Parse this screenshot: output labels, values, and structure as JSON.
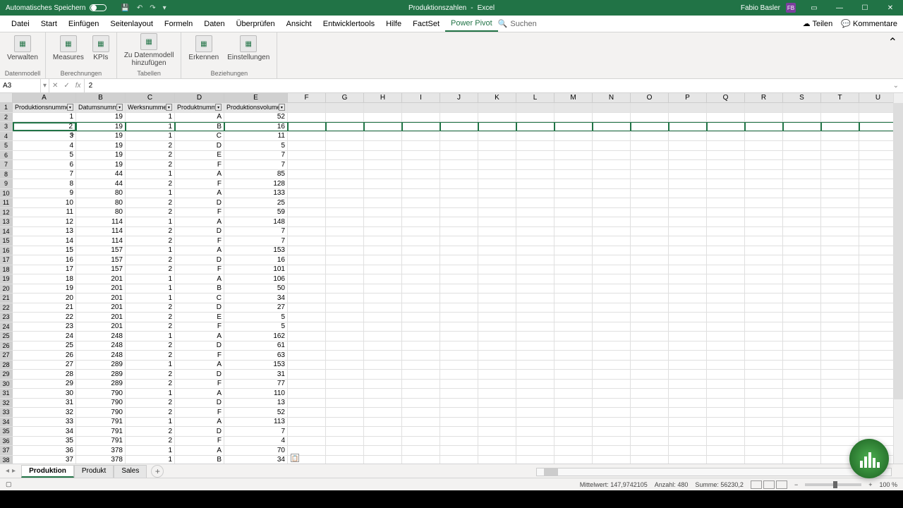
{
  "titlebar": {
    "autosave_label": "Automatisches Speichern",
    "doc_title": "Produktionszahlen",
    "app_name": "Excel",
    "user_name": "Fabio Basler",
    "user_initials": "FB"
  },
  "menu": {
    "tabs": [
      "Datei",
      "Start",
      "Einfügen",
      "Seitenlayout",
      "Formeln",
      "Daten",
      "Überprüfen",
      "Ansicht",
      "Entwicklertools",
      "Hilfe",
      "FactSet",
      "Power Pivot"
    ],
    "active_index": 11,
    "search_label": "Suchen",
    "share_label": "Teilen",
    "comments_label": "Kommentare"
  },
  "ribbon": {
    "groups": [
      {
        "label": "Datenmodell",
        "buttons": [
          {
            "label": "Verwalten"
          }
        ]
      },
      {
        "label": "Berechnungen",
        "buttons": [
          {
            "label": "Measures"
          },
          {
            "label": "KPIs"
          }
        ]
      },
      {
        "label": "Tabellen",
        "buttons": [
          {
            "label": "Zu Datenmodell\nhinzufügen"
          }
        ]
      },
      {
        "label": "Beziehungen",
        "buttons": [
          {
            "label": "Erkennen"
          },
          {
            "label": "Einstellungen"
          }
        ]
      }
    ]
  },
  "formula_bar": {
    "name_box": "A3",
    "formula": "2"
  },
  "grid": {
    "col_widths": {
      "A": 90,
      "B": 70,
      "C": 70,
      "D": 70,
      "E": 90,
      "rest": 54
    },
    "col_letters": [
      "A",
      "B",
      "C",
      "D",
      "E",
      "F",
      "G",
      "H",
      "I",
      "J",
      "K",
      "L",
      "M",
      "N",
      "O",
      "P",
      "Q",
      "R",
      "S",
      "T",
      "U"
    ],
    "table_headers": [
      "Produktionsnummer",
      "Datumsnummer",
      "Werksnummer",
      "Produktnummer",
      "Produktionsvolumen"
    ],
    "active_cell": "A3",
    "chart_data": {
      "type": "table",
      "columns": [
        "Produktionsnummer",
        "Datumsnummer",
        "Werksnummer",
        "Produktnummer",
        "Produktionsvolumen"
      ],
      "rows": [
        [
          1,
          19,
          1,
          "A",
          52
        ],
        [
          2,
          19,
          1,
          "B",
          16
        ],
        [
          3,
          19,
          1,
          "C",
          11
        ],
        [
          4,
          19,
          2,
          "D",
          5
        ],
        [
          5,
          19,
          2,
          "E",
          7
        ],
        [
          6,
          19,
          2,
          "F",
          7
        ],
        [
          7,
          44,
          1,
          "A",
          85
        ],
        [
          8,
          44,
          2,
          "F",
          128
        ],
        [
          9,
          80,
          1,
          "A",
          133
        ],
        [
          10,
          80,
          2,
          "D",
          25
        ],
        [
          11,
          80,
          2,
          "F",
          59
        ],
        [
          12,
          114,
          1,
          "A",
          148
        ],
        [
          13,
          114,
          2,
          "D",
          7
        ],
        [
          14,
          114,
          2,
          "F",
          7
        ],
        [
          15,
          157,
          1,
          "A",
          153
        ],
        [
          16,
          157,
          2,
          "D",
          16
        ],
        [
          17,
          157,
          2,
          "F",
          101
        ],
        [
          18,
          201,
          1,
          "A",
          106
        ],
        [
          19,
          201,
          1,
          "B",
          50
        ],
        [
          20,
          201,
          1,
          "C",
          34
        ],
        [
          21,
          201,
          2,
          "D",
          27
        ],
        [
          22,
          201,
          2,
          "E",
          5
        ],
        [
          23,
          201,
          2,
          "F",
          5
        ],
        [
          24,
          248,
          1,
          "A",
          162
        ],
        [
          25,
          248,
          2,
          "D",
          61
        ],
        [
          26,
          248,
          2,
          "F",
          63
        ],
        [
          27,
          289,
          1,
          "A",
          153
        ],
        [
          28,
          289,
          2,
          "D",
          31
        ],
        [
          29,
          289,
          2,
          "F",
          77
        ],
        [
          30,
          790,
          1,
          "A",
          110
        ],
        [
          31,
          790,
          2,
          "D",
          13
        ],
        [
          32,
          790,
          2,
          "F",
          52
        ],
        [
          33,
          791,
          1,
          "A",
          113
        ],
        [
          34,
          791,
          2,
          "D",
          7
        ],
        [
          35,
          791,
          2,
          "F",
          4
        ],
        [
          36,
          378,
          1,
          "A",
          70
        ],
        [
          37,
          378,
          1,
          "B",
          34
        ]
      ]
    }
  },
  "sheet_tabs": {
    "tabs": [
      "Produktion",
      "Produkt",
      "Sales"
    ],
    "active_index": 0
  },
  "statusbar": {
    "mittelwert_label": "Mittelwert:",
    "mittelwert": "147,9742105",
    "anzahl_label": "Anzahl:",
    "anzahl": "480",
    "summe_label": "Summe:",
    "summe": "56230,2",
    "zoom": "100 %"
  }
}
